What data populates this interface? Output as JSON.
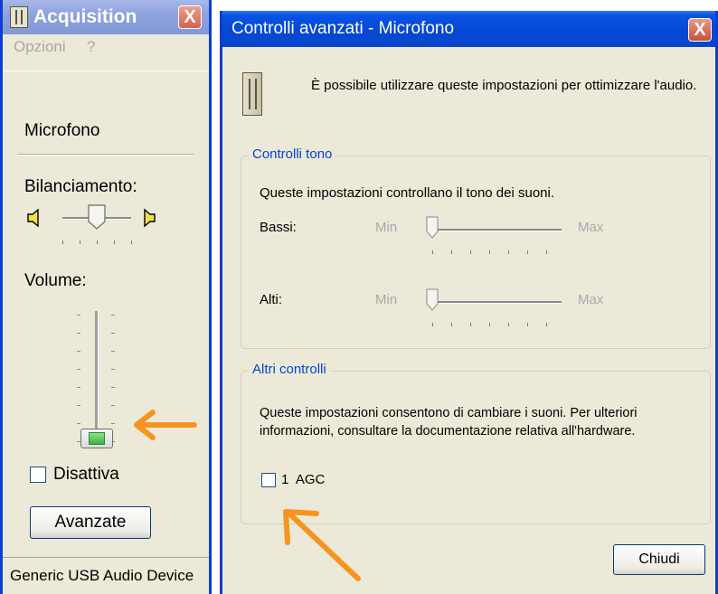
{
  "left_window": {
    "title": "Acquisition",
    "close_label": "X",
    "menu": [
      "Opzioni",
      "?"
    ],
    "device_label": "Microfono",
    "balance_label": "Bilanciamento:",
    "volume_label": "Volume:",
    "volume_level": 0,
    "mute_label": "Disattiva",
    "mute_checked": false,
    "advanced_button": "Avanzate",
    "status": "Generic USB Audio Device"
  },
  "right_window": {
    "title": "Controlli avanzati - Microfono",
    "close_label": "X",
    "intro": "È possibile utilizzare queste impostazioni per ottimizzare l'audio.",
    "tone_group": {
      "legend": "Controlli tono",
      "description": "Queste impostazioni controllano il tono dei suoni.",
      "bass_label": "Bassi:",
      "treble_label": "Alti:",
      "min_label": "Min",
      "max_label": "Max"
    },
    "other_group": {
      "legend": "Altri controlli",
      "description_line1": "Queste impostazioni consentono di cambiare i suoni. Per ulteriori",
      "description_line2": "informazioni, consultare la documentazione relativa all'hardware.",
      "agc_label": "1  AGC",
      "agc_checked": false
    },
    "close_button": "Chiudi"
  },
  "colors": {
    "titlebar_blue": "#0548d6",
    "dialog_bg": "#ece9d8",
    "legend_blue": "#0046d5",
    "annotation_arrow": "#f7941d"
  },
  "icons": [
    "mixer-icon",
    "close-icon",
    "speaker-left-icon",
    "speaker-right-icon",
    "annotation-arrow-icon"
  ]
}
